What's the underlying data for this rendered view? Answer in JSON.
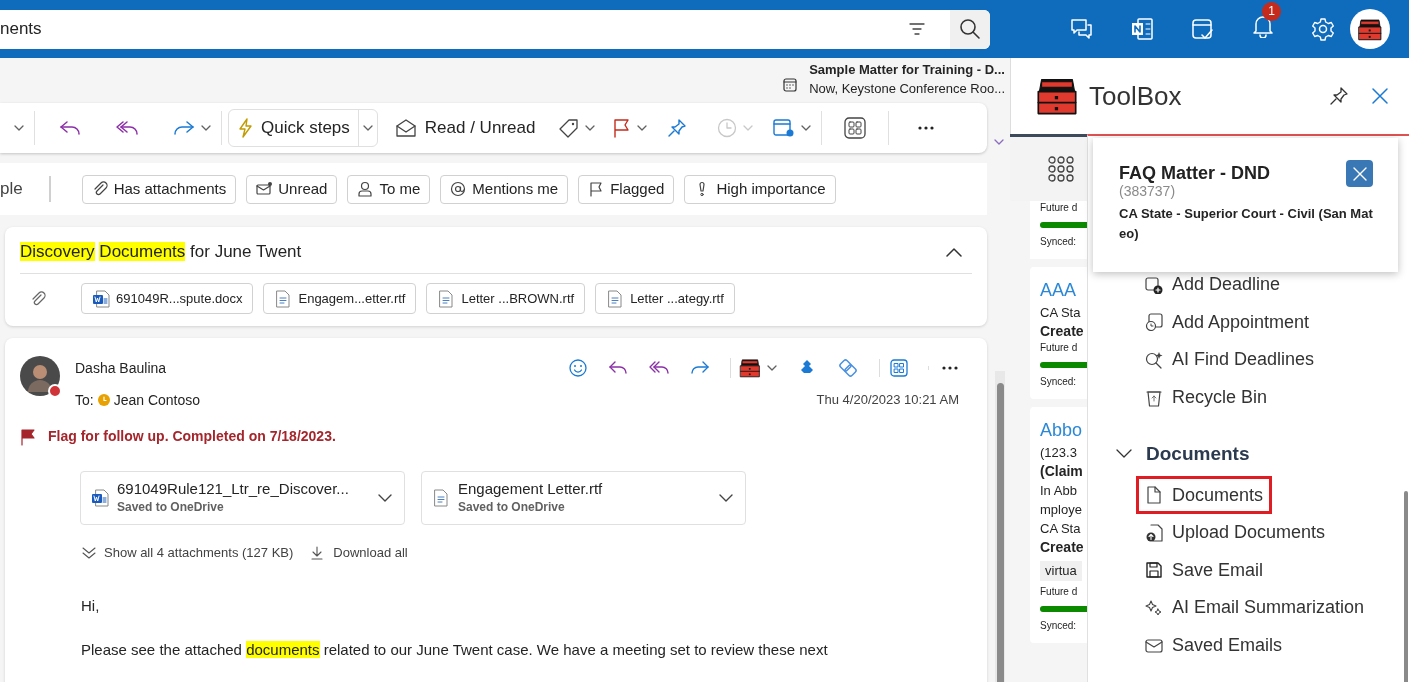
{
  "search": {
    "value": "nents"
  },
  "top_bar": {
    "notification_count": "1"
  },
  "reminder": {
    "title": "Sample Matter for Training - D...",
    "detail": "Now, Keystone Conference Roo..."
  },
  "toolbar": {
    "quick_steps": "Quick steps",
    "read_unread": "Read / Unread"
  },
  "filters": {
    "cut_label": "ple",
    "chips": [
      {
        "label": "Has attachments",
        "kind": "clip"
      },
      {
        "label": "Unread",
        "kind": "mail"
      },
      {
        "label": "To me",
        "kind": "person"
      },
      {
        "label": "Mentions me",
        "kind": "at"
      },
      {
        "label": "Flagged",
        "kind": "flag"
      },
      {
        "label": "High importance",
        "kind": "important"
      }
    ]
  },
  "conversation": {
    "subject": [
      {
        "text": "Discovery",
        "highlighted": true
      },
      {
        "text": "Documents",
        "highlighted": true
      },
      {
        "text": " for June Twent",
        "highlighted": false
      }
    ],
    "attachments": [
      {
        "name": "691049R...spute.docx",
        "kind": "word"
      },
      {
        "name": "Engagem...etter.rtf",
        "kind": "text"
      },
      {
        "name": "Letter ...BROWN.rtf",
        "kind": "text"
      },
      {
        "name": "Letter ...ategy.rtf",
        "kind": "text"
      }
    ]
  },
  "message": {
    "sender": "Dasha Baulina",
    "to_label": "To:",
    "recipient": "Jean Contoso",
    "date": "Thu 4/20/2023 10:21 AM",
    "flag_text": "Flag for follow up. Completed on 7/18/2023.",
    "attachments": [
      {
        "name": "691049Rule121_Ltr_re_Discover...",
        "status": "Saved to OneDrive",
        "kind": "word"
      },
      {
        "name": "Engagement Letter.rtf",
        "status": "Saved to OneDrive",
        "kind": "text"
      }
    ],
    "show_all": "Show all 4 attachments (127 KB)",
    "download_all": "Download all",
    "body": [
      [
        {
          "text": "Hi,",
          "highlighted": false
        }
      ],
      [
        {
          "text": "Please see the attached ",
          "highlighted": false
        },
        {
          "text": "documents",
          "highlighted": true
        },
        {
          "text": " related to our June Twent case. We have a meeting set to review these next",
          "highlighted": false
        }
      ]
    ]
  },
  "toolbox": {
    "title": "ToolBox",
    "matter_cards": [
      {
        "lines": [
          {
            "text": "Future d",
            "kind": "small"
          },
          {
            "kind": "bar",
            "level": 1
          },
          {
            "text": "Synced:",
            "kind": "small"
          }
        ]
      },
      {
        "lines": [
          {
            "text": "AAA",
            "kind": "title"
          },
          {
            "text": "CA Sta",
            "kind": "plain"
          },
          {
            "text": "Create",
            "kind": "bold"
          },
          {
            "text": "Future d",
            "kind": "small"
          },
          {
            "kind": "bar",
            "level": 1
          },
          {
            "text": "Synced:",
            "kind": "small"
          }
        ]
      },
      {
        "lines": [
          {
            "text": "Abbo",
            "kind": "title"
          },
          {
            "text": "(123.3",
            "kind": "plain"
          },
          {
            "text": "(Claim",
            "kind": "bold"
          },
          {
            "text": "In Abb",
            "kind": "plain"
          },
          {
            "text": "mploye",
            "kind": "plain"
          },
          {
            "text": "CA Sta",
            "kind": "plain"
          },
          {
            "text": "Create",
            "kind": "bold"
          },
          {
            "text": "virtua",
            "kind": "tag"
          },
          {
            "text": "Future d",
            "kind": "small"
          },
          {
            "kind": "bar",
            "level": 1
          },
          {
            "text": "Synced:",
            "kind": "small"
          }
        ]
      }
    ],
    "popup": {
      "title": "FAQ Matter - DND",
      "number": "(383737)",
      "court": "CA State - Superior Court - Civil (San Mateo)"
    },
    "actions": [
      {
        "label": "Add Deadline",
        "kind": "deadline"
      },
      {
        "label": "Add Appointment",
        "kind": "appointment"
      },
      {
        "label": "AI Find Deadlines",
        "kind": "ai-search"
      },
      {
        "label": "Recycle Bin",
        "kind": "bin"
      }
    ],
    "section": {
      "label": "Documents",
      "expanded": true,
      "items": [
        {
          "label": "Documents",
          "kind": "document",
          "selected": true
        },
        {
          "label": "Upload Documents",
          "kind": "upload",
          "selected": false
        },
        {
          "label": "Save Email",
          "kind": "save",
          "selected": false
        },
        {
          "label": "AI Email Summarization",
          "kind": "sparkle",
          "selected": false
        },
        {
          "label": "Saved Emails",
          "kind": "mail",
          "selected": false
        }
      ]
    }
  }
}
